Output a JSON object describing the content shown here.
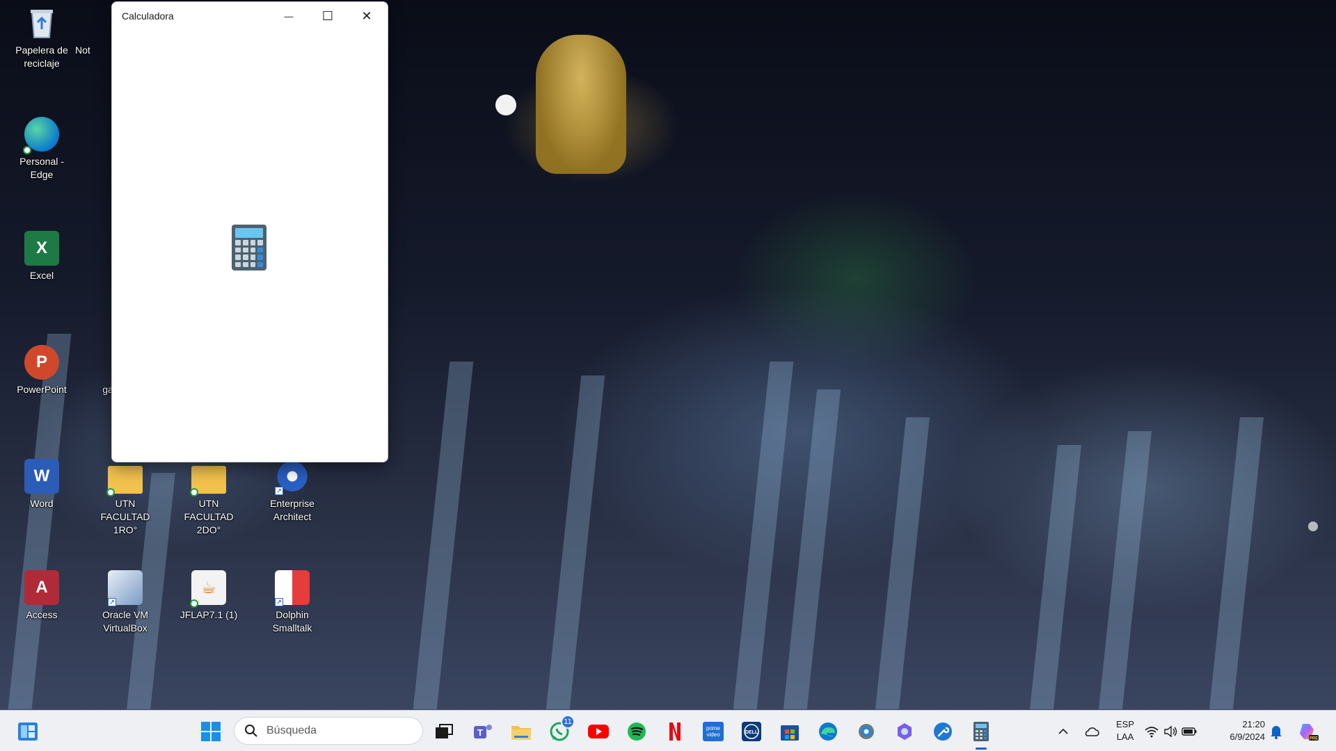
{
  "desktop": {
    "icons": [
      {
        "label": "Papelera de reciclaje",
        "icon": "recycle-bin-icon"
      },
      {
        "label": "Not",
        "icon": "notepad-icon"
      },
      {
        "label": "Personal - Edge",
        "icon": "edge-icon"
      },
      {
        "label": "Excel",
        "icon": "excel-icon",
        "letter": "X"
      },
      {
        "label": "PowerPoint",
        "icon": "powerpoint-icon",
        "letter": "P"
      },
      {
        "label": "ga",
        "icon": "app-icon"
      },
      {
        "label": "Word",
        "icon": "word-icon",
        "letter": "W"
      },
      {
        "label": "UTN FACULTAD 1RO°",
        "icon": "folder-icon"
      },
      {
        "label": "UTN FACULTAD 2DO°",
        "icon": "folder-icon"
      },
      {
        "label": "Enterprise Architect",
        "icon": "enterprise-architect-icon"
      },
      {
        "label": "Access",
        "icon": "access-icon",
        "letter": "A"
      },
      {
        "label": "Oracle VM VirtualBox",
        "icon": "virtualbox-icon"
      },
      {
        "label": "JFLAP7.1 (1)",
        "icon": "java-icon"
      },
      {
        "label": "Dolphin Smalltalk",
        "icon": "dolphin-smalltalk-icon"
      }
    ]
  },
  "window": {
    "title": "Calculadora",
    "minimize_glyph": "—",
    "maximize_glyph": "☐",
    "close_glyph": "✕"
  },
  "taskbar": {
    "search_placeholder": "Búsqueda",
    "whatsapp_badge": "11",
    "language_line1": "ESP",
    "language_line2": "LAA",
    "time": "21:20",
    "date": "6/9/2024",
    "colors": {
      "accent": "#0a64c8",
      "background": "#eef0f3"
    }
  }
}
